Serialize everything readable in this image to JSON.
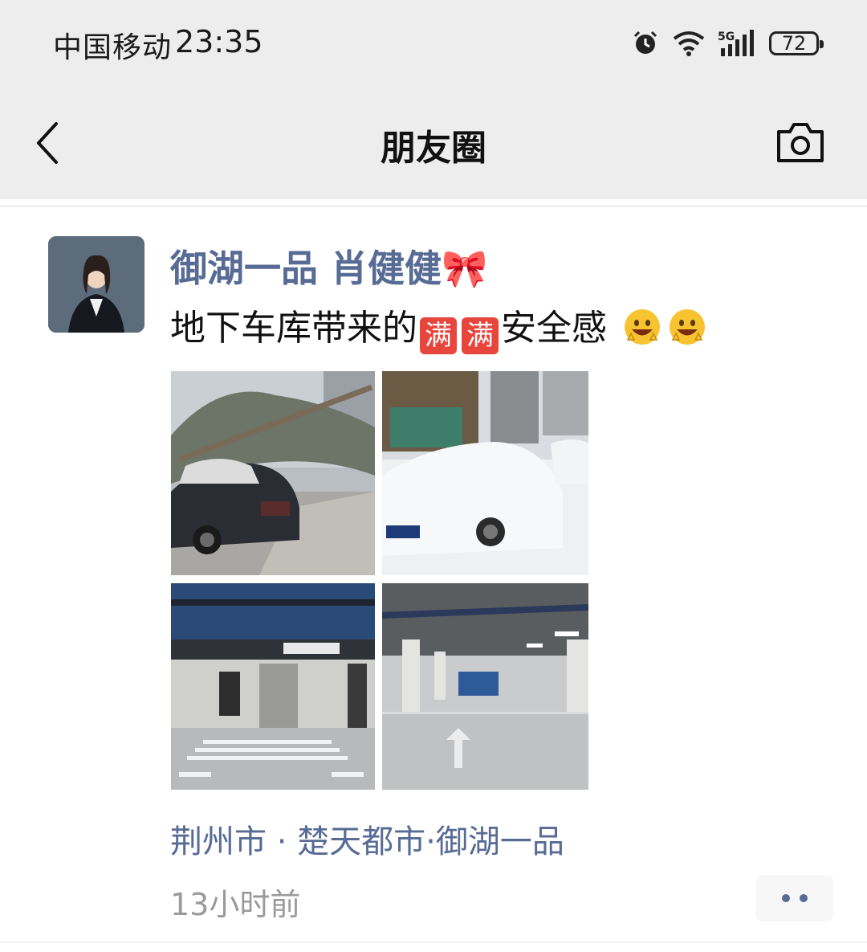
{
  "status_bar": {
    "carrier": "中国移动",
    "time": "23:35",
    "network": "5G",
    "battery": "72",
    "icons": [
      "alarm-icon",
      "wifi-icon",
      "signal-5g-icon",
      "battery-icon"
    ]
  },
  "nav": {
    "title": "朋友圈",
    "back_icon": "chevron-left-icon",
    "camera_icon": "camera-icon"
  },
  "post": {
    "author": "御湖一品  肖健健🎀",
    "text_main": "地下车库带来的",
    "badge_char": "满",
    "text_after": "安全感",
    "emoji": [
      "grinning-face-icon",
      "grinning-face-icon"
    ],
    "photos": [
      {
        "name": "snow-tree-fallen-on-car-photo"
      },
      {
        "name": "snow-covered-white-car-photo"
      },
      {
        "name": "underground-garage-entrance-photo"
      },
      {
        "name": "underground-garage-lane-photo"
      }
    ],
    "location": "荆州市 · 楚天都市·御湖一品",
    "time": "13小时前",
    "more_icon": "more-dots-icon"
  },
  "colors": {
    "header_bg": "#ededed",
    "link_blue": "#576b95",
    "time_gray": "#9a9a9a",
    "badge_red": "#e8453c"
  }
}
